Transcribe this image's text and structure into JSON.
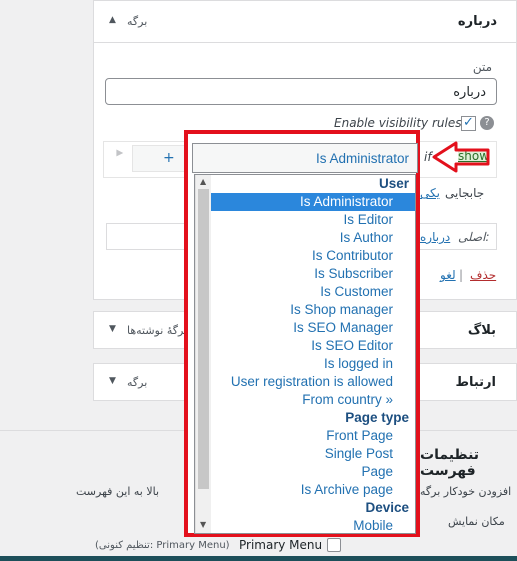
{
  "widgets": {
    "about": {
      "title": "درباره",
      "type": "برگه"
    },
    "blog": {
      "title": "بلاگ",
      "type": "بُرگهٔ نوشته‌ها"
    },
    "contact": {
      "title": "ارتباط",
      "type": "برگه"
    }
  },
  "form": {
    "text_label": "متن",
    "text_value": "درباره",
    "visibility_label": "Enable visibility rules",
    "help_glyph": "?",
    "add_glyph": "+",
    "show_label": "show",
    "if_label": "if",
    "move_text": "جابجایی",
    "move_link": "یکی",
    "original_label": "اصلی:",
    "original_link": "درباره",
    "delete_link": "حذف",
    "sep": "|",
    "cancel_link": "لغو"
  },
  "dropdown": {
    "selected": "Is Administrator",
    "groups": [
      {
        "label": "User",
        "options": [
          "Is Administrator",
          "Is Editor",
          "Is Author",
          "Is Contributor",
          "Is Subscriber",
          "Is Customer",
          "Is Shop manager",
          "Is SEO Manager",
          "Is SEO Editor",
          "Is logged in",
          "User registration is allowed",
          "From country »"
        ]
      },
      {
        "label": "Page type",
        "options": [
          "Front Page",
          "Single Post",
          "Page",
          "Is Archive page"
        ]
      },
      {
        "label": "Device",
        "options": [
          "Mobile"
        ]
      }
    ]
  },
  "menu_settings": {
    "title": "تنظیمات فهرست",
    "auto_add": "افزودن خودکار برگه",
    "auto_add_tail": "بالا به این فهرست",
    "location_label": "مکان نمایش",
    "primary_menu": "Primary Menu",
    "primary_note": "(تنظیم کنونی: Primary Menu)"
  },
  "colors": {
    "accent": "#2271b1",
    "highlight_frame": "#e3101c",
    "selected": "#2b87dc"
  },
  "icons": {
    "caret": "▲",
    "caret_down": "▼",
    "check": "✓",
    "arrow": "⇦"
  }
}
